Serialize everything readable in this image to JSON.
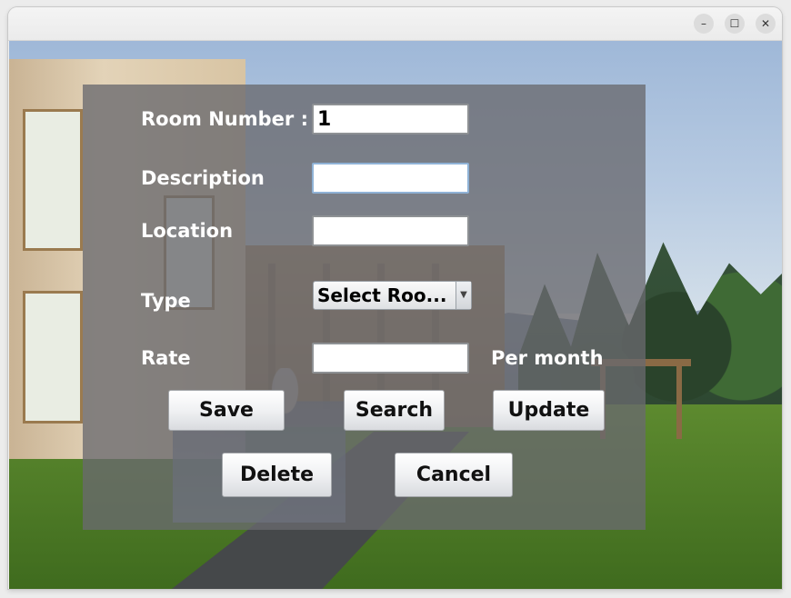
{
  "window": {
    "minimize_glyph": "–",
    "maximize_glyph": "☐",
    "close_glyph": "✕"
  },
  "form": {
    "room_number_label": "Room Number :",
    "room_number_value": "1",
    "description_label": "Description",
    "description_value": "",
    "location_label": "Location",
    "location_value": "",
    "type_label": "Type",
    "type_selected": "Select Roo...",
    "rate_label": "Rate",
    "rate_value": "",
    "rate_unit": "Per month"
  },
  "buttons": {
    "save": "Save",
    "search": "Search",
    "update": "Update",
    "delete": "Delete",
    "cancel": "Cancel"
  },
  "icons": {
    "dropdown": "chevron-down-icon"
  }
}
